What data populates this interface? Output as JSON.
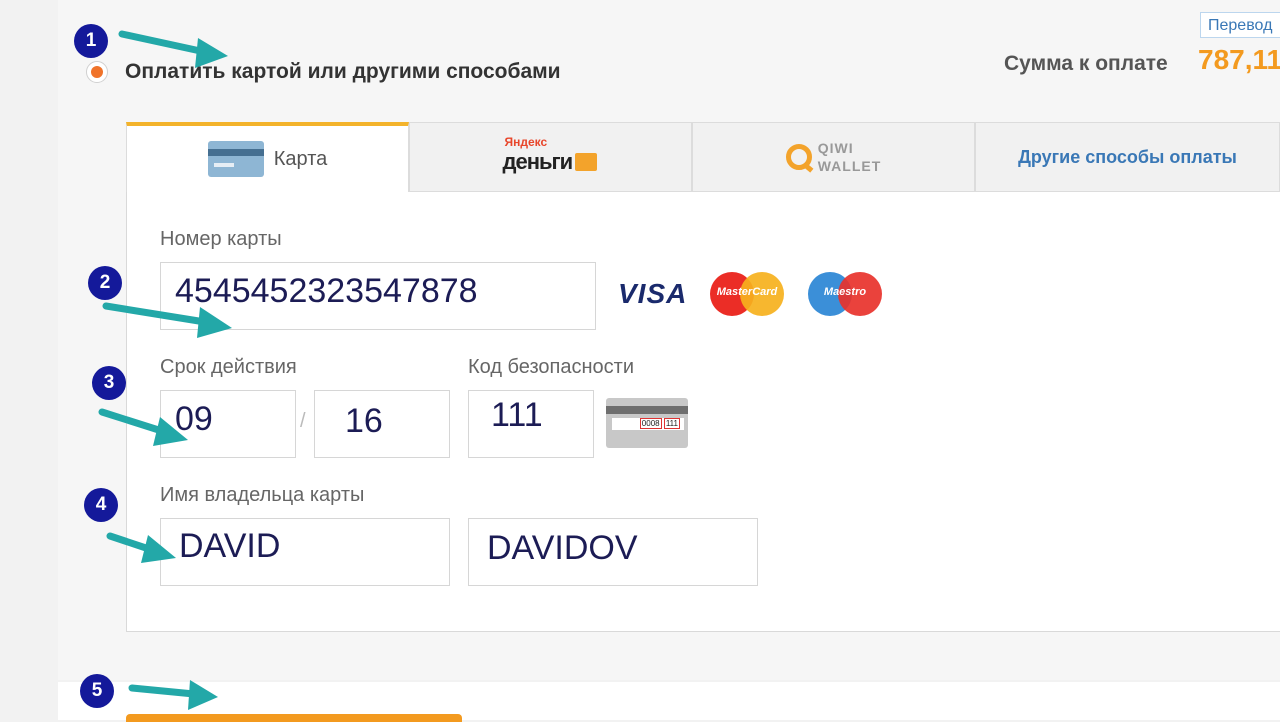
{
  "header": {
    "translate_link": "Перевод",
    "sum_label": "Сумма к оплате",
    "sum_value": "787,11"
  },
  "payment_option": {
    "label": "Оплатить картой или другими способами",
    "selected": true
  },
  "tabs": [
    {
      "label": "Карта",
      "icon": "card-icon",
      "active": true
    },
    {
      "label": "Яндекс ДЕНЬГИ",
      "logo_top": "Яндекс",
      "logo_bottom": "деньги",
      "icon": "wallet-icon"
    },
    {
      "label": "QIWI WALLET",
      "logo_text": "QIWI\nWALLET",
      "icon": "qiwi-logo"
    },
    {
      "label": "Другие способы оплаты"
    }
  ],
  "form": {
    "card_number_label": "Номер карты",
    "card_number_value": "4545452323547878",
    "expiry_label": "Срок действия",
    "expiry_month": "09",
    "expiry_separator": "/",
    "expiry_year": "16",
    "cvc_label": "Код безопасности",
    "cvc_value": "111",
    "cvc_card_digits": "0008",
    "cvc_card_code": "111",
    "holder_label": "Имя владельца карты",
    "holder_first": "DAVID",
    "holder_last": "DAVIDOV"
  },
  "card_brands": {
    "visa": "VISA",
    "mastercard": "MasterCard",
    "maestro": "Maestro"
  },
  "steps": [
    "1",
    "2",
    "3",
    "4",
    "5"
  ],
  "colors": {
    "accent_orange": "#f39a1f",
    "link_blue": "#3a78b6",
    "badge_blue": "#14199a",
    "arrow_teal": "#23a8a8"
  }
}
